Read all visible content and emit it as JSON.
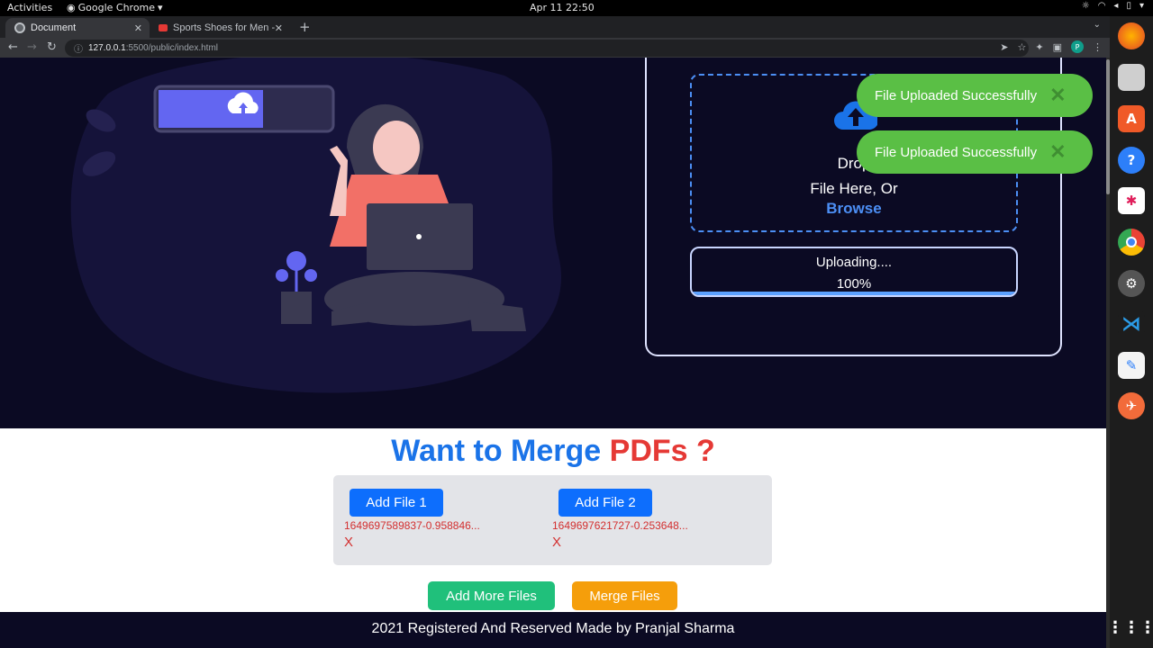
{
  "system_bar": {
    "activities": "Activities",
    "app_name": "Google Chrome",
    "clock": "Apr 11  22:50"
  },
  "browser": {
    "tabs": [
      {
        "title": "Document",
        "active": true
      },
      {
        "title": "Sports Shoes for Men - Bu",
        "active": false
      }
    ],
    "url_host": "127.0.0.1",
    "url_rest": ":5500/public/index.html"
  },
  "upload": {
    "drop_text_line1": "Drop",
    "drop_text_line2": "File Here, Or",
    "browse_label": "Browse",
    "status_text": "Uploading....",
    "progress_percent": "100%",
    "progress_value": 100
  },
  "toasts": [
    {
      "message": "File Uploaded Successfully"
    },
    {
      "message": "File Uploaded Successfully"
    }
  ],
  "merge": {
    "heading_part1": "Want to Merge",
    "heading_part2": "PDFs ?",
    "files": [
      {
        "button_label": "Add File 1",
        "file_name": "1649697589837-0.958846...",
        "remove_label": "X"
      },
      {
        "button_label": "Add File 2",
        "file_name": "1649697621727-0.253648...",
        "remove_label": "X"
      }
    ],
    "add_more_label": "Add More Files",
    "merge_label": "Merge Files"
  },
  "footer": {
    "text": "2021 Registered And Reserved Made by Pranjal Sharma"
  },
  "colors": {
    "hero_bg": "#0b0a23",
    "accent_blue": "#1a73e8",
    "accent_red": "#e53935",
    "toast_green": "#5abf45",
    "add_more_green": "#20c07b",
    "merge_orange": "#f59e0b"
  },
  "dock_icons": [
    "firefox-icon",
    "files-icon",
    "software-icon",
    "help-icon",
    "slack-icon",
    "chrome-icon",
    "settings-icon",
    "vscode-icon",
    "text-editor-icon",
    "postman-icon",
    "app-grid-icon"
  ]
}
